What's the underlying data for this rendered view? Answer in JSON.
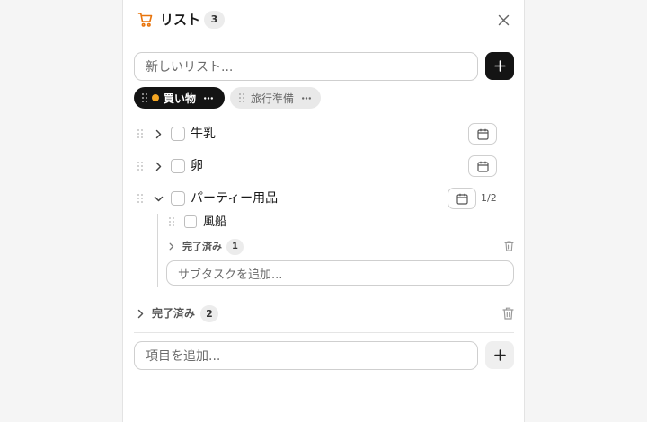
{
  "header": {
    "title": "リスト",
    "count": "3"
  },
  "new_list": {
    "placeholder": "新しいリスト..."
  },
  "chips": [
    {
      "label": "買い物",
      "dot_color": "#f5a623"
    },
    {
      "label": "旅行準備"
    }
  ],
  "items": [
    {
      "label": "牛乳"
    },
    {
      "label": "卵"
    },
    {
      "label": "パーティー用品",
      "progress": "1/2",
      "subtasks": [
        {
          "label": "風船"
        }
      ],
      "completed": {
        "label": "完了済み",
        "count": "1"
      },
      "add_subtask_placeholder": "サブタスクを追加..."
    }
  ],
  "completed": {
    "label": "完了済み",
    "count": "2"
  },
  "add_item": {
    "placeholder": "項目を追加..."
  },
  "colors": {
    "accent": "#e8740c",
    "dark": "#141414"
  }
}
